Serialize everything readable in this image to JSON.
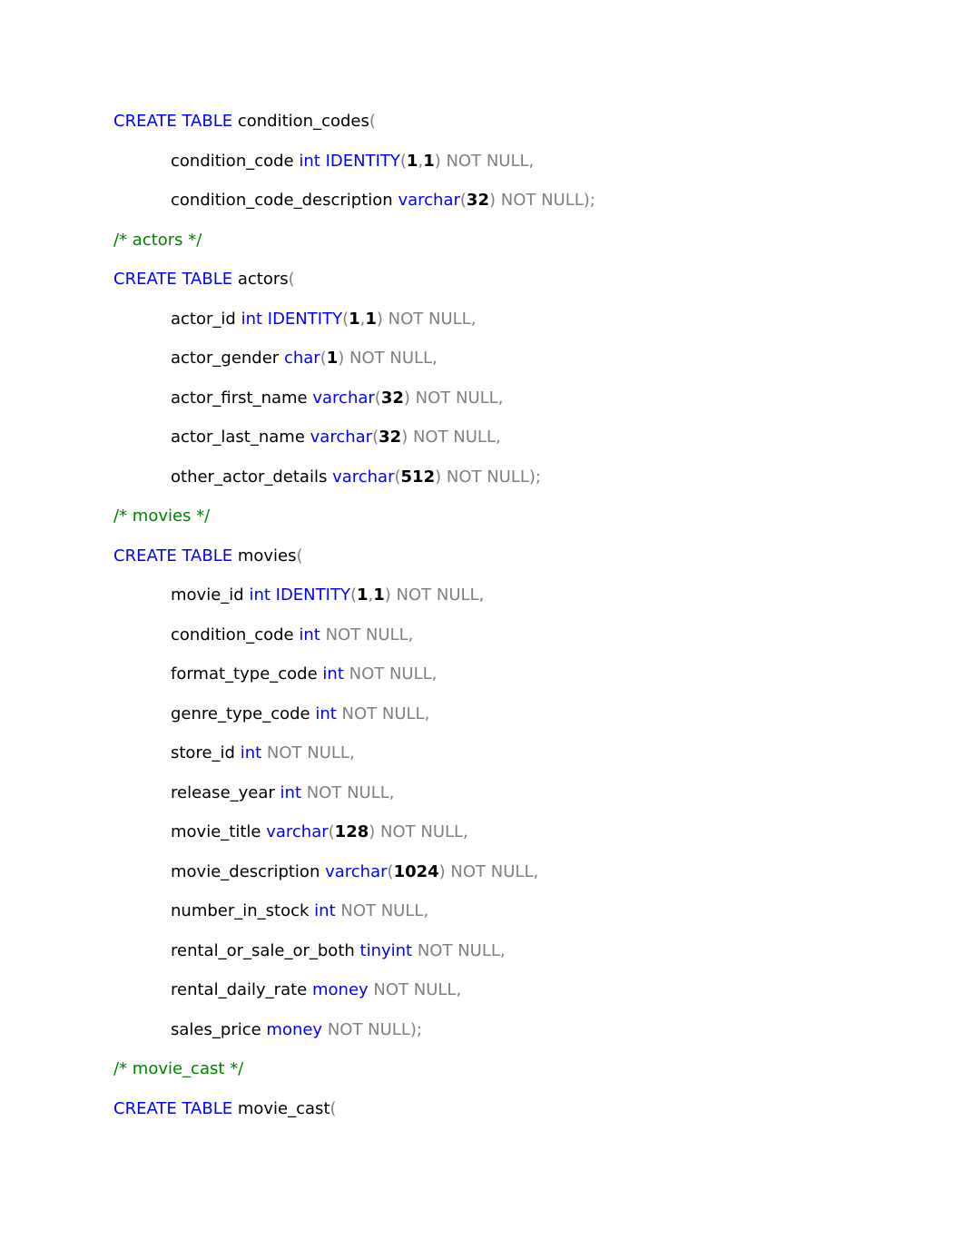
{
  "document": {
    "type": "sql-ddl-script",
    "colors": {
      "keyword": "#0000ff",
      "comment": "#008000",
      "muted": "#808080",
      "identifier": "#000000",
      "number": "#000000",
      "background": "#ffffff"
    },
    "lines": [
      {
        "id": "create-table-condition-codes",
        "indent": false,
        "tokens": [
          {
            "t": "CREATE TABLE",
            "c": "kw"
          },
          {
            "t": " ",
            "c": "ident"
          },
          {
            "t": "condition_codes",
            "c": "ident"
          },
          {
            "t": "(",
            "c": "muted"
          }
        ]
      },
      {
        "id": "condition-codes-col-condition-code",
        "indent": true,
        "tokens": [
          {
            "t": "condition_code",
            "c": "ident"
          },
          {
            "t": " ",
            "c": "ident"
          },
          {
            "t": "int",
            "c": "kw"
          },
          {
            "t": " ",
            "c": "ident"
          },
          {
            "t": "IDENTITY",
            "c": "kw"
          },
          {
            "t": "(",
            "c": "muted"
          },
          {
            "t": "1",
            "c": "num"
          },
          {
            "t": ",",
            "c": "muted"
          },
          {
            "t": "1",
            "c": "num"
          },
          {
            "t": ")",
            "c": "muted"
          },
          {
            "t": " NOT NULL,",
            "c": "muted"
          }
        ]
      },
      {
        "id": "condition-codes-col-condition-code-description",
        "indent": true,
        "tokens": [
          {
            "t": "condition_code_description",
            "c": "ident"
          },
          {
            "t": " ",
            "c": "ident"
          },
          {
            "t": "varchar",
            "c": "kw"
          },
          {
            "t": "(",
            "c": "muted"
          },
          {
            "t": "32",
            "c": "num"
          },
          {
            "t": ")",
            "c": "muted"
          },
          {
            "t": " NOT NULL);",
            "c": "muted"
          }
        ]
      },
      {
        "id": "comment-actors",
        "indent": false,
        "tokens": [
          {
            "t": "/* actors */",
            "c": "comment"
          }
        ]
      },
      {
        "id": "create-table-actors",
        "indent": false,
        "tokens": [
          {
            "t": "CREATE TABLE",
            "c": "kw"
          },
          {
            "t": " ",
            "c": "ident"
          },
          {
            "t": "actors",
            "c": "ident"
          },
          {
            "t": "(",
            "c": "muted"
          }
        ]
      },
      {
        "id": "actors-col-actor-id",
        "indent": true,
        "tokens": [
          {
            "t": "actor_id",
            "c": "ident"
          },
          {
            "t": " ",
            "c": "ident"
          },
          {
            "t": "int",
            "c": "kw"
          },
          {
            "t": " ",
            "c": "ident"
          },
          {
            "t": "IDENTITY",
            "c": "kw"
          },
          {
            "t": "(",
            "c": "muted"
          },
          {
            "t": "1",
            "c": "num"
          },
          {
            "t": ",",
            "c": "muted"
          },
          {
            "t": "1",
            "c": "num"
          },
          {
            "t": ")",
            "c": "muted"
          },
          {
            "t": " NOT NULL,",
            "c": "muted"
          }
        ]
      },
      {
        "id": "actors-col-actor-gender",
        "indent": true,
        "tokens": [
          {
            "t": "actor_gender",
            "c": "ident"
          },
          {
            "t": " ",
            "c": "ident"
          },
          {
            "t": "char",
            "c": "kw"
          },
          {
            "t": "(",
            "c": "muted"
          },
          {
            "t": "1",
            "c": "num"
          },
          {
            "t": ")",
            "c": "muted"
          },
          {
            "t": " NOT NULL,",
            "c": "muted"
          }
        ]
      },
      {
        "id": "actors-col-actor-first-name",
        "indent": true,
        "tokens": [
          {
            "t": "actor_first_name",
            "c": "ident"
          },
          {
            "t": " ",
            "c": "ident"
          },
          {
            "t": "varchar",
            "c": "kw"
          },
          {
            "t": "(",
            "c": "muted"
          },
          {
            "t": "32",
            "c": "num"
          },
          {
            "t": ")",
            "c": "muted"
          },
          {
            "t": " NOT NULL,",
            "c": "muted"
          }
        ]
      },
      {
        "id": "actors-col-actor-last-name",
        "indent": true,
        "tokens": [
          {
            "t": "actor_last_name",
            "c": "ident"
          },
          {
            "t": " ",
            "c": "ident"
          },
          {
            "t": "varchar",
            "c": "kw"
          },
          {
            "t": "(",
            "c": "muted"
          },
          {
            "t": "32",
            "c": "num"
          },
          {
            "t": ")",
            "c": "muted"
          },
          {
            "t": " NOT NULL,",
            "c": "muted"
          }
        ]
      },
      {
        "id": "actors-col-other-actor-details",
        "indent": true,
        "tokens": [
          {
            "t": "other_actor_details",
            "c": "ident"
          },
          {
            "t": " ",
            "c": "ident"
          },
          {
            "t": "varchar",
            "c": "kw"
          },
          {
            "t": "(",
            "c": "muted"
          },
          {
            "t": "512",
            "c": "num"
          },
          {
            "t": ")",
            "c": "muted"
          },
          {
            "t": " NOT NULL);",
            "c": "muted"
          }
        ]
      },
      {
        "id": "comment-movies",
        "indent": false,
        "tokens": [
          {
            "t": "/* movies */",
            "c": "comment"
          }
        ]
      },
      {
        "id": "create-table-movies",
        "indent": false,
        "tokens": [
          {
            "t": "CREATE TABLE",
            "c": "kw"
          },
          {
            "t": " ",
            "c": "ident"
          },
          {
            "t": "movies",
            "c": "ident"
          },
          {
            "t": "(",
            "c": "muted"
          }
        ]
      },
      {
        "id": "movies-col-movie-id",
        "indent": true,
        "tokens": [
          {
            "t": "movie_id",
            "c": "ident"
          },
          {
            "t": " ",
            "c": "ident"
          },
          {
            "t": "int",
            "c": "kw"
          },
          {
            "t": " ",
            "c": "ident"
          },
          {
            "t": "IDENTITY",
            "c": "kw"
          },
          {
            "t": "(",
            "c": "muted"
          },
          {
            "t": "1",
            "c": "num"
          },
          {
            "t": ",",
            "c": "muted"
          },
          {
            "t": "1",
            "c": "num"
          },
          {
            "t": ")",
            "c": "muted"
          },
          {
            "t": " NOT NULL,",
            "c": "muted"
          }
        ]
      },
      {
        "id": "movies-col-condition-code",
        "indent": true,
        "tokens": [
          {
            "t": "condition_code",
            "c": "ident"
          },
          {
            "t": " ",
            "c": "ident"
          },
          {
            "t": "int",
            "c": "kw"
          },
          {
            "t": " NOT NULL,",
            "c": "muted"
          }
        ]
      },
      {
        "id": "movies-col-format-type-code",
        "indent": true,
        "tokens": [
          {
            "t": "format_type_code",
            "c": "ident"
          },
          {
            "t": " ",
            "c": "ident"
          },
          {
            "t": "int",
            "c": "kw"
          },
          {
            "t": " NOT NULL,",
            "c": "muted"
          }
        ]
      },
      {
        "id": "movies-col-genre-type-code",
        "indent": true,
        "tokens": [
          {
            "t": "genre_type_code",
            "c": "ident"
          },
          {
            "t": " ",
            "c": "ident"
          },
          {
            "t": "int",
            "c": "kw"
          },
          {
            "t": " NOT NULL,",
            "c": "muted"
          }
        ]
      },
      {
        "id": "movies-col-store-id",
        "indent": true,
        "tokens": [
          {
            "t": "store_id",
            "c": "ident"
          },
          {
            "t": " ",
            "c": "ident"
          },
          {
            "t": "int",
            "c": "kw"
          },
          {
            "t": " NOT NULL,",
            "c": "muted"
          }
        ]
      },
      {
        "id": "movies-col-release-year",
        "indent": true,
        "tokens": [
          {
            "t": "release_year",
            "c": "ident"
          },
          {
            "t": " ",
            "c": "ident"
          },
          {
            "t": "int",
            "c": "kw"
          },
          {
            "t": " NOT NULL,",
            "c": "muted"
          }
        ]
      },
      {
        "id": "movies-col-movie-title",
        "indent": true,
        "tokens": [
          {
            "t": "movie_title",
            "c": "ident"
          },
          {
            "t": " ",
            "c": "ident"
          },
          {
            "t": "varchar",
            "c": "kw"
          },
          {
            "t": "(",
            "c": "muted"
          },
          {
            "t": "128",
            "c": "num"
          },
          {
            "t": ")",
            "c": "muted"
          },
          {
            "t": " NOT NULL,",
            "c": "muted"
          }
        ]
      },
      {
        "id": "movies-col-movie-description",
        "indent": true,
        "tokens": [
          {
            "t": "movie_description",
            "c": "ident"
          },
          {
            "t": " ",
            "c": "ident"
          },
          {
            "t": "varchar",
            "c": "kw"
          },
          {
            "t": "(",
            "c": "muted"
          },
          {
            "t": "1024",
            "c": "num"
          },
          {
            "t": ")",
            "c": "muted"
          },
          {
            "t": " NOT NULL,",
            "c": "muted"
          }
        ]
      },
      {
        "id": "movies-col-number-in-stock",
        "indent": true,
        "tokens": [
          {
            "t": "number_in_stock",
            "c": "ident"
          },
          {
            "t": " ",
            "c": "ident"
          },
          {
            "t": "int",
            "c": "kw"
          },
          {
            "t": " NOT NULL,",
            "c": "muted"
          }
        ]
      },
      {
        "id": "movies-col-rental-or-sale-or-both",
        "indent": true,
        "tokens": [
          {
            "t": "rental_or_sale_or_both",
            "c": "ident"
          },
          {
            "t": " ",
            "c": "ident"
          },
          {
            "t": "tinyint",
            "c": "kw"
          },
          {
            "t": " NOT NULL,",
            "c": "muted"
          }
        ]
      },
      {
        "id": "movies-col-rental-daily-rate",
        "indent": true,
        "tokens": [
          {
            "t": "rental_daily_rate",
            "c": "ident"
          },
          {
            "t": " ",
            "c": "ident"
          },
          {
            "t": "money",
            "c": "kw"
          },
          {
            "t": " NOT NULL,",
            "c": "muted"
          }
        ]
      },
      {
        "id": "movies-col-sales-price",
        "indent": true,
        "tokens": [
          {
            "t": "sales_price",
            "c": "ident"
          },
          {
            "t": " ",
            "c": "ident"
          },
          {
            "t": "money",
            "c": "kw"
          },
          {
            "t": " NOT NULL);",
            "c": "muted"
          }
        ]
      },
      {
        "id": "comment-movie-cast",
        "indent": false,
        "tokens": [
          {
            "t": "/* movie_cast */",
            "c": "comment"
          }
        ]
      },
      {
        "id": "create-table-movie-cast",
        "indent": false,
        "tokens": [
          {
            "t": "CREATE TABLE",
            "c": "kw"
          },
          {
            "t": " ",
            "c": "ident"
          },
          {
            "t": "movie_cast",
            "c": "ident"
          },
          {
            "t": "(",
            "c": "muted"
          }
        ]
      }
    ]
  }
}
